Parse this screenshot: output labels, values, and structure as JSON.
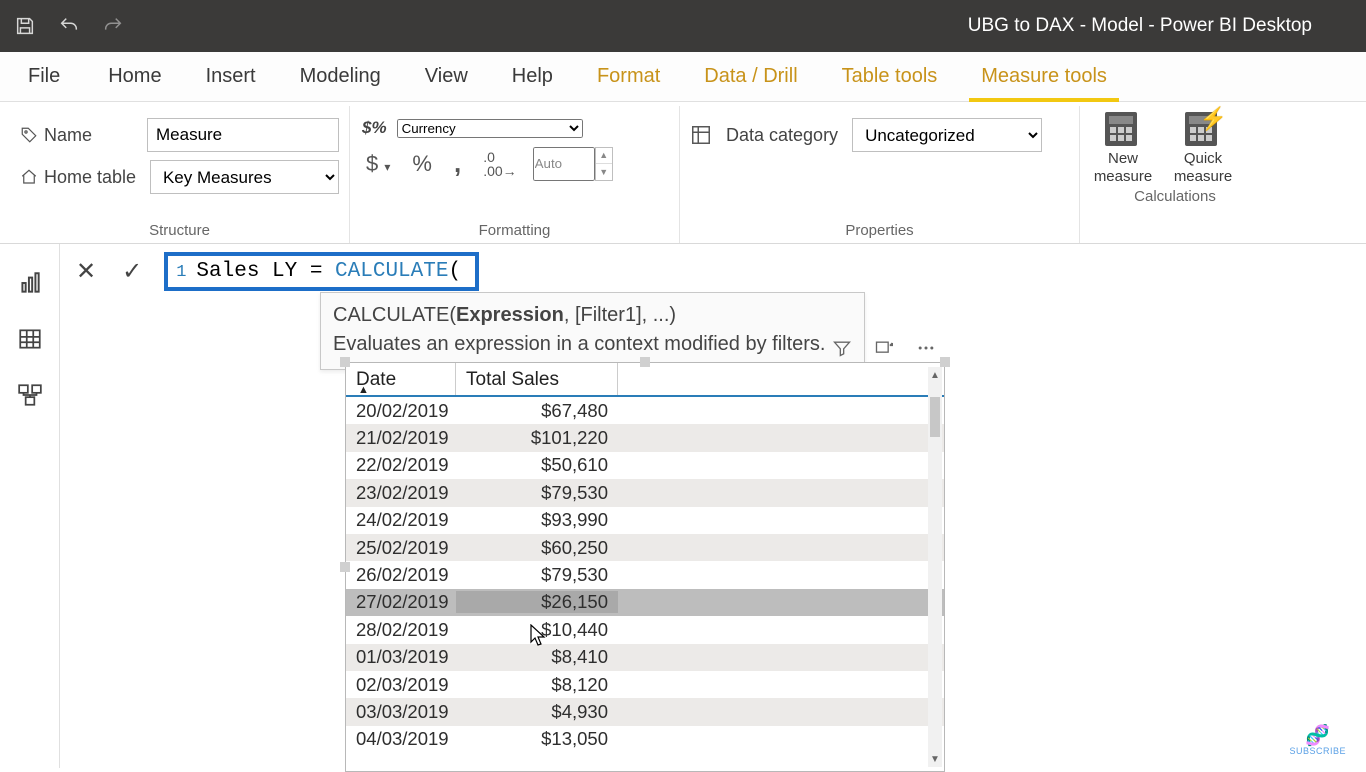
{
  "titlebar": {
    "title": "UBG to DAX - Model - Power BI Desktop"
  },
  "ribbon": {
    "tabs": {
      "file": "File",
      "home": "Home",
      "insert": "Insert",
      "modeling": "Modeling",
      "view": "View",
      "help": "Help",
      "format": "Format",
      "data_drill": "Data / Drill",
      "table_tools": "Table tools",
      "measure_tools": "Measure tools"
    },
    "structure": {
      "name_label": "Name",
      "name_value": "Measure",
      "hometable_label": "Home table",
      "hometable_value": "Key Measures",
      "caption": "Structure"
    },
    "formatting": {
      "format_value": "Currency",
      "decimal_value": "Auto",
      "caption": "Formatting"
    },
    "properties": {
      "datacat_label": "Data category",
      "datacat_value": "Uncategorized",
      "caption": "Properties"
    },
    "calculations": {
      "new_measure": "New measure",
      "quick_measure": "Quick measure",
      "caption": "Calculations"
    }
  },
  "formula": {
    "line_no": "1",
    "text_prefix": "Sales LY = ",
    "text_func": "CALCULATE",
    "text_suffix": "(",
    "tooltip_sig_pre": "CALCULATE(",
    "tooltip_sig_bold": "Expression",
    "tooltip_sig_post": ", [Filter1], ...)",
    "tooltip_desc": "Evaluates an expression in a context modified by filters."
  },
  "table": {
    "headers": {
      "date": "Date",
      "sales": "Total Sales"
    },
    "rows": [
      {
        "date": "20/02/2019",
        "sales": "$67,480"
      },
      {
        "date": "21/02/2019",
        "sales": "$101,220"
      },
      {
        "date": "22/02/2019",
        "sales": "$50,610"
      },
      {
        "date": "23/02/2019",
        "sales": "$79,530"
      },
      {
        "date": "24/02/2019",
        "sales": "$93,990"
      },
      {
        "date": "25/02/2019",
        "sales": "$60,250"
      },
      {
        "date": "26/02/2019",
        "sales": "$79,530"
      },
      {
        "date": "27/02/2019",
        "sales": "$26,150"
      },
      {
        "date": "28/02/2019",
        "sales": "$10,440"
      },
      {
        "date": "01/03/2019",
        "sales": "$8,410"
      },
      {
        "date": "02/03/2019",
        "sales": "$8,120"
      },
      {
        "date": "03/03/2019",
        "sales": "$4,930"
      },
      {
        "date": "04/03/2019",
        "sales": "$13,050"
      }
    ],
    "selected_index": 7
  },
  "subscribe": "SUBSCRIBE"
}
